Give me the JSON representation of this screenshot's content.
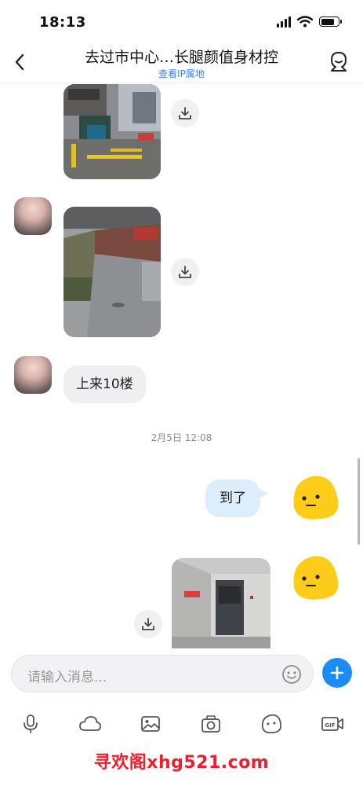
{
  "status_bar": {
    "time": "18:13"
  },
  "header": {
    "title": "去过市中心…长腿颜值身材控",
    "subtitle": "查看IP属地",
    "back_icon": "chevron-left-icon",
    "profile_icon": "user-profile-icon"
  },
  "messages": {
    "text_1": "上来10楼",
    "timestamp_1": "2月5日 12:08",
    "text_2": "到了"
  },
  "input": {
    "placeholder": "请输入消息..."
  },
  "toolbar": {
    "items": [
      "microphone-icon",
      "cloud-icon",
      "image-icon",
      "camera-icon",
      "sticker-icon",
      "gif-video-icon"
    ]
  },
  "watermark": {
    "text": "寻欢阁xhg521.com"
  },
  "colors": {
    "accent": "#1a8cf3",
    "link": "#3a86e8",
    "bubble_right": "#dcedfc",
    "bubble_left": "#efeff1",
    "watermark": "#ef1e2a",
    "emoji_yellow": "#ffcc1a"
  }
}
